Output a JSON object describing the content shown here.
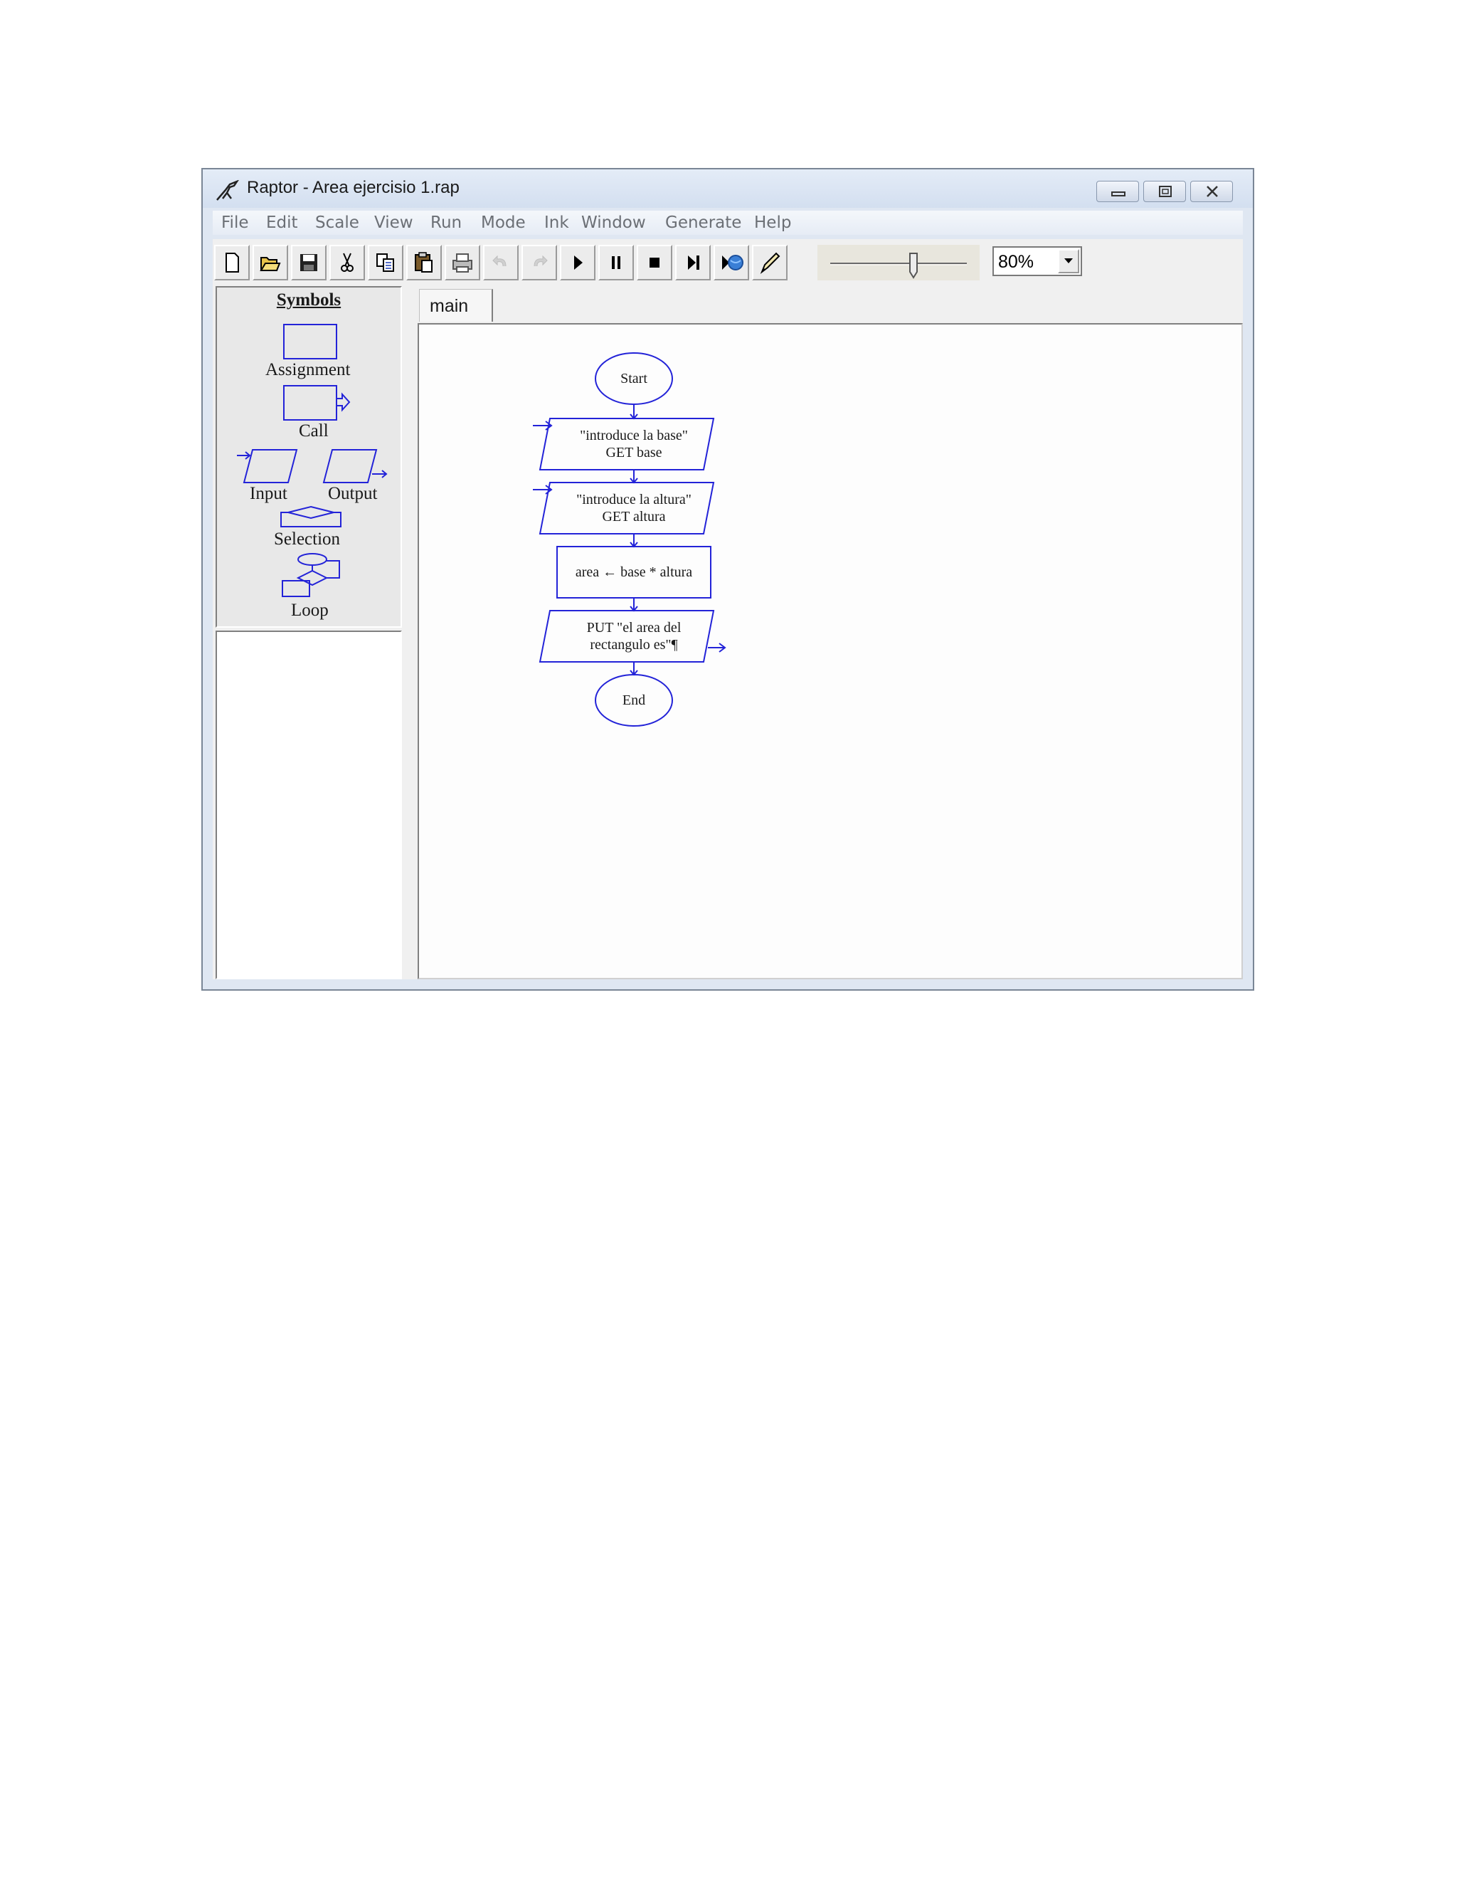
{
  "window": {
    "title": "Raptor - Area ejercisio 1.rap"
  },
  "menu": [
    "File",
    "Edit",
    "Scale",
    "View",
    "Run",
    "Mode",
    "Ink",
    "Window",
    "Generate",
    "Help"
  ],
  "toolbar": {
    "buttons": [
      "new-file-icon",
      "open-folder-icon",
      "save-icon",
      "cut-icon",
      "copy-icon",
      "paste-icon",
      "print-icon",
      "undo-icon",
      "redo-icon",
      "play-icon",
      "pause-icon",
      "stop-icon",
      "step-icon",
      "test-server-icon",
      "ink-pen-icon"
    ],
    "zoom": "80%"
  },
  "symbols": {
    "title": "Symbols",
    "assignment": "Assignment",
    "call": "Call",
    "input": "Input",
    "output": "Output",
    "selection": "Selection",
    "loop": "Loop"
  },
  "tabs": [
    "main"
  ],
  "flowchart": {
    "start": "Start",
    "input1_prompt": "\"introduce la base\"",
    "input1_get": "GET base",
    "input2_prompt": "\"introduce la altura\"",
    "input2_get": "GET altura",
    "assignment": "area ← base * altura",
    "output_line1": "PUT \"el area del",
    "output_line2": "rectangulo es\"¶",
    "end": "End"
  },
  "colors": {
    "flow_stroke": "#2323d8",
    "title_bar": "#d3dff0"
  }
}
